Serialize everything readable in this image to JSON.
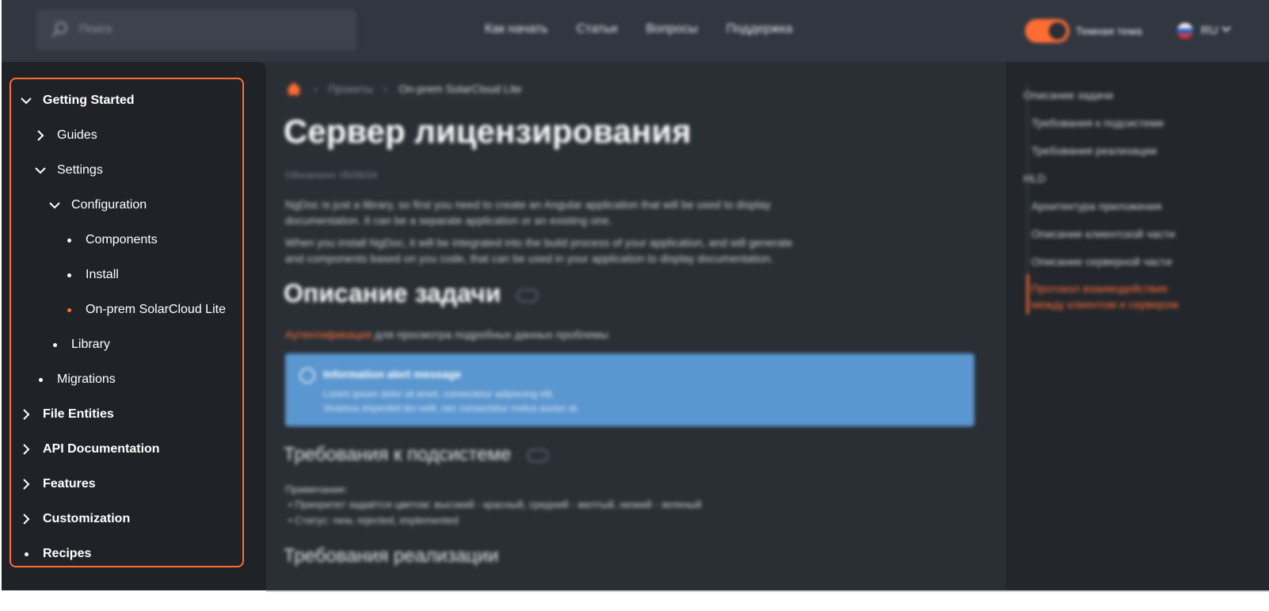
{
  "header": {
    "search_placeholder": "Поиск",
    "nav": [
      "Как начать",
      "Статьи",
      "Вопросы",
      "Поддержка"
    ],
    "theme_label": "Темная тема",
    "theme_enabled": true,
    "lang": "RU",
    "accent": "#ff6d33"
  },
  "breadcrumb": {
    "home_icon": "home-icon",
    "items": [
      "Проекты",
      "On-prem SolarCloud Lite"
    ]
  },
  "content": {
    "title": "Сервер лицензирования",
    "updated": "Обновлено: 05/06/24",
    "p1_l1": "NgDoc is just a library, so first you need to create an Angular application that will be used to display",
    "p1_l2": "documentation. It can be a separate application or an existing one.",
    "p2_l1": "When you install NgDoc, it will be integrated into the build process of your application, and will generate",
    "p2_l2": "and components based on you code, that can be used in your application to display documentation.",
    "h_task": "Описание задачи",
    "auth_link": "Аутентификация",
    "auth_rest": " для просмотра подробных данных проблемы",
    "alert_title": "Information alert message",
    "alert_l1": "Lorem ipsum dolor sit amet, consectetur adipiscing elit.",
    "alert_l2": "Vivamus imperdiet leo velit, nec consectetur metus auctor at.",
    "h_sub": "Требования к подсистеме",
    "note": "Примечание:",
    "bullet1": "Приоритет задаётся цветом: высокий - красный, средний - желтый, низкий - зеленый",
    "bullet2": "Статус: new, rejected, implemented",
    "h_impl": "Требования реализации"
  },
  "toc": {
    "items": [
      "Описание задачи",
      "Требования к подсистеме",
      "Требования реализации",
      "HLD",
      "Архитектура приложения",
      "Описание клиентской части",
      "Описание серверной части"
    ],
    "active_l1": "Протокол взаимодействия",
    "active_l2": "между клиентом и сервером"
  },
  "sidebar": {
    "items": [
      {
        "label": "Getting Started",
        "icon": "chevron-down-icon"
      },
      {
        "label": "Guides",
        "icon": "chevron-right-icon"
      },
      {
        "label": "Settings",
        "icon": "chevron-down-icon"
      },
      {
        "label": "Configuration",
        "icon": "chevron-down-icon"
      },
      {
        "label": "Components",
        "icon": "bullet-icon"
      },
      {
        "label": "Install",
        "icon": "bullet-icon"
      },
      {
        "label": "On-prem SolarCloud Lite",
        "icon": "bullet-icon",
        "active": true
      },
      {
        "label": "Library",
        "icon": "bullet-icon"
      },
      {
        "label": "Migrations",
        "icon": "bullet-icon"
      },
      {
        "label": "File Entities",
        "icon": "chevron-right-icon"
      },
      {
        "label": "API Documentation",
        "icon": "chevron-right-icon"
      },
      {
        "label": "Features",
        "icon": "chevron-right-icon"
      },
      {
        "label": "Customization",
        "icon": "chevron-right-icon"
      },
      {
        "label": "Recipes",
        "icon": "bullet-icon"
      }
    ]
  }
}
